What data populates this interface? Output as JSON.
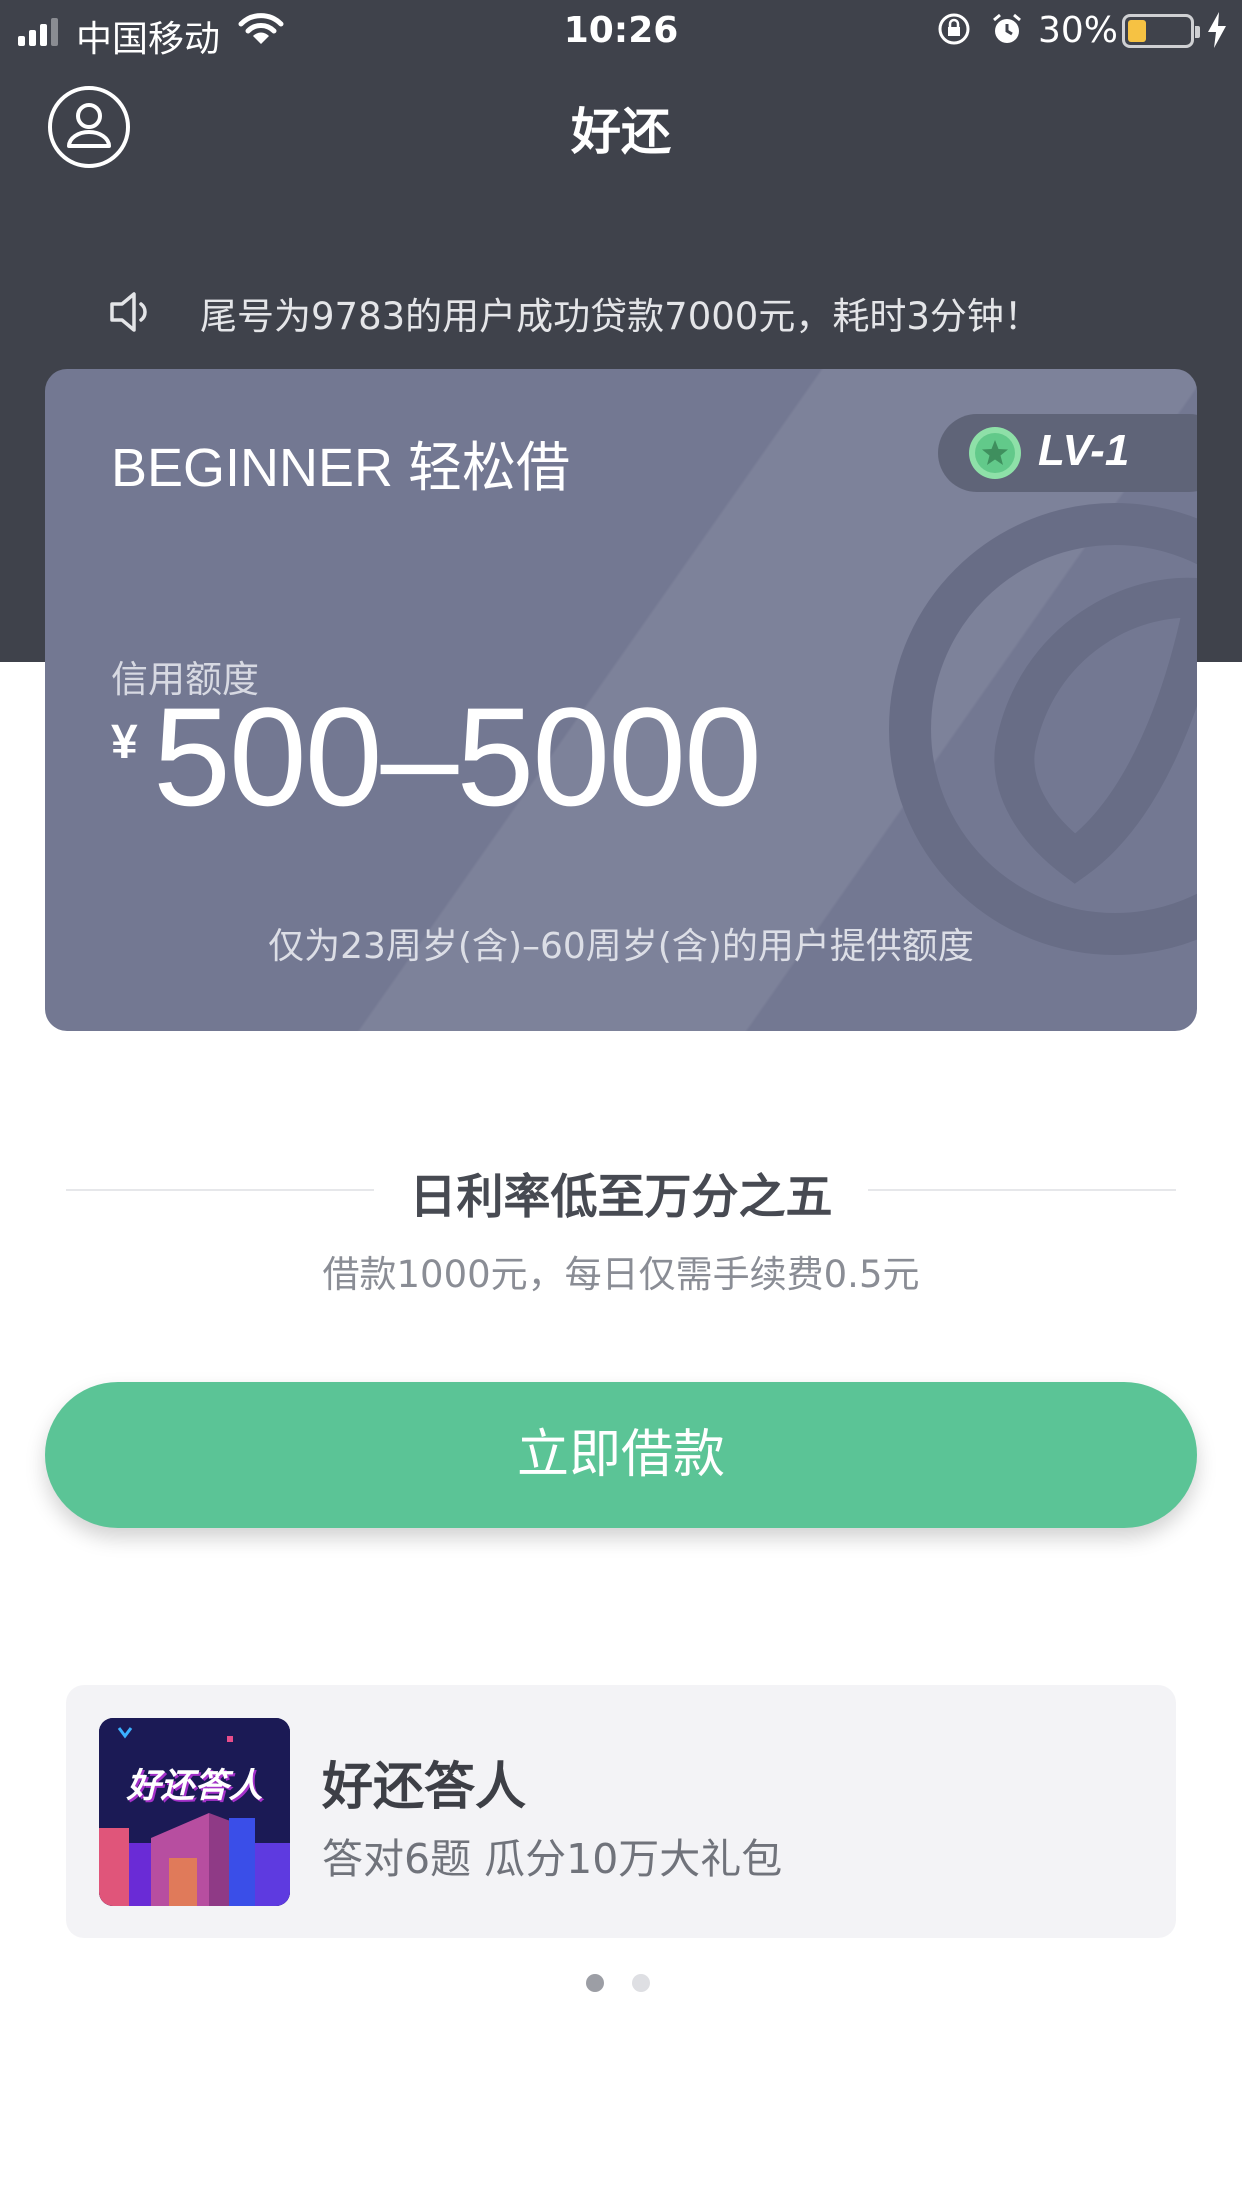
{
  "status_bar": {
    "carrier": "中国移动",
    "time": "10:26",
    "battery_percent": "30%",
    "battery_level": 0.3,
    "signal_bars_active": 3,
    "signal_bars_total": 4
  },
  "nav": {
    "title": "好还",
    "profile_icon": "user-profile-icon"
  },
  "notice": {
    "icon": "speaker-icon",
    "text": "尾号为9783的用户成功贷款7000元，耗时3分钟！"
  },
  "credit_card": {
    "title": "BEGINNER 轻松借",
    "level": "LV-1",
    "level_icon": "star-badge-icon",
    "credit_label": "信用额度",
    "currency_symbol": "¥",
    "credit_range": "500–5000",
    "age_note": "仅为23周岁(含)–60周岁(含)的用户提供额度"
  },
  "rate": {
    "title": "日利率低至万分之五",
    "subtitle": "借款1000元，每日仅需手续费0.5元"
  },
  "borrow_button": {
    "label": "立即借款"
  },
  "promo": {
    "thumb_text": "好还答人",
    "title": "好还答人",
    "subtitle": "答对6题  瓜分10万大礼包"
  },
  "carousel": {
    "page_count": 2,
    "active_index": 0
  },
  "colors": {
    "header_bg": "#3f424b",
    "card_bg": "#737892",
    "accent_green": "#5bc496",
    "battery_yellow": "#f6c243"
  }
}
